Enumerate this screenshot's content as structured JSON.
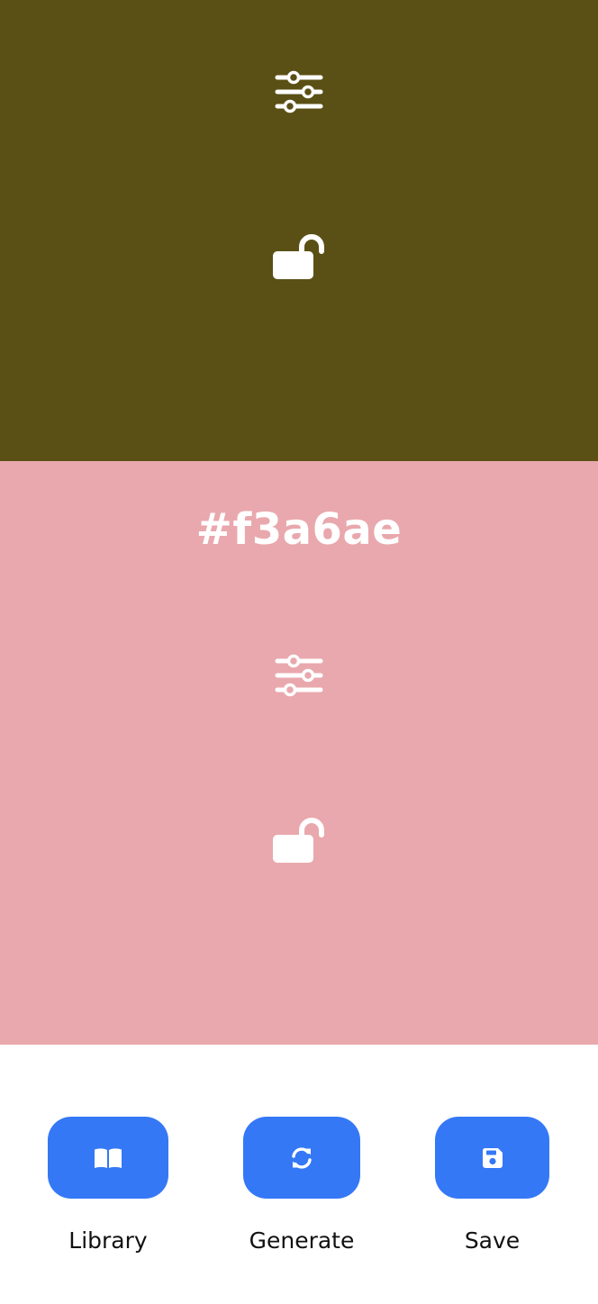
{
  "palette": [
    {
      "color": "#5a5015",
      "hex_label": ""
    },
    {
      "color": "#e9a8ad",
      "hex_label": "#f3a6ae"
    }
  ],
  "icons": {
    "adjust": "sliders-icon",
    "lock": "unlocked-icon"
  },
  "toolbar": {
    "accent_color": "#3478f6",
    "library_label": "Library",
    "generate_label": "Generate",
    "save_label": "Save"
  }
}
